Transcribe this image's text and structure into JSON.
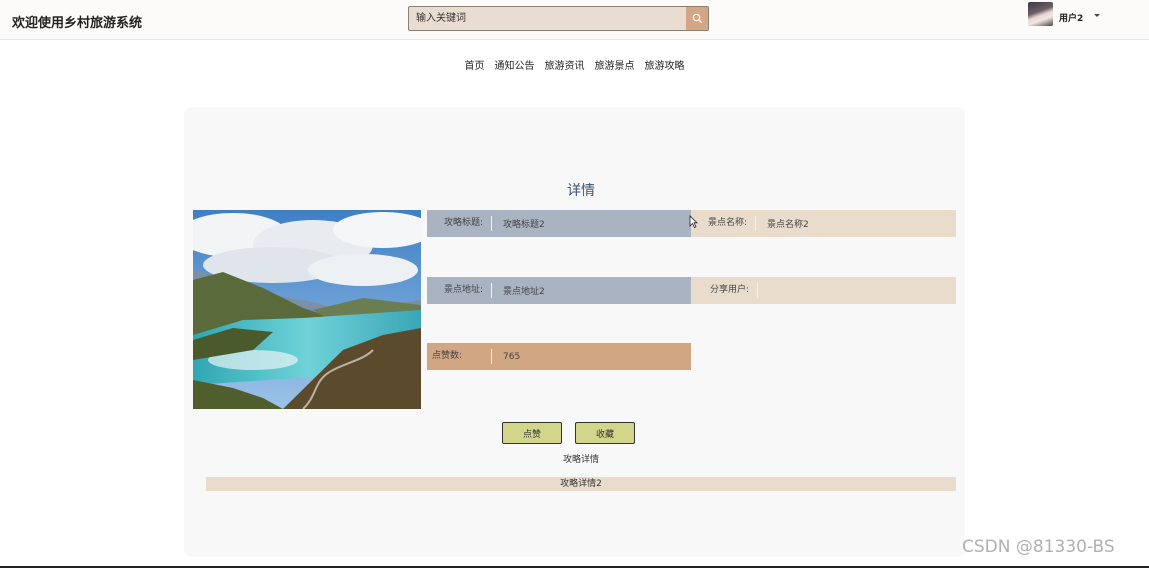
{
  "header": {
    "site_title": "欢迎使用乡村旅游系统",
    "search_placeholder": "输入关键词",
    "username": "用户2"
  },
  "nav": {
    "items": [
      "首页",
      "通知公告",
      "旅游资讯",
      "旅游景点",
      "旅游攻略"
    ]
  },
  "detail": {
    "heading": "详情",
    "fields": {
      "guide_title": {
        "label": "攻略标题:",
        "value": "攻略标题2"
      },
      "spot_name": {
        "label": "景点名称:",
        "value": "景点名称2"
      },
      "spot_address": {
        "label": "景点地址:",
        "value": "景点地址2"
      },
      "share_user": {
        "label": "分享用户:",
        "value": ""
      },
      "likes": {
        "label": "点赞数:",
        "value": "765"
      }
    },
    "like_button": "点赞",
    "favorite_button": "收藏",
    "description_label": "攻略详情",
    "description": "攻略详情2"
  },
  "watermark": "CSDN @81330-BS",
  "colors": {
    "field_blue": "#aab3c2",
    "field_tan": "#e9dccd",
    "field_orange": "#d1a683",
    "button": "#d3d68a",
    "search_button": "#d3a685",
    "heading": "#3d4f6e"
  },
  "icons": {
    "search": "search-icon",
    "dropdown": "caret-down-icon",
    "cursor": "mouse-cursor-icon"
  }
}
